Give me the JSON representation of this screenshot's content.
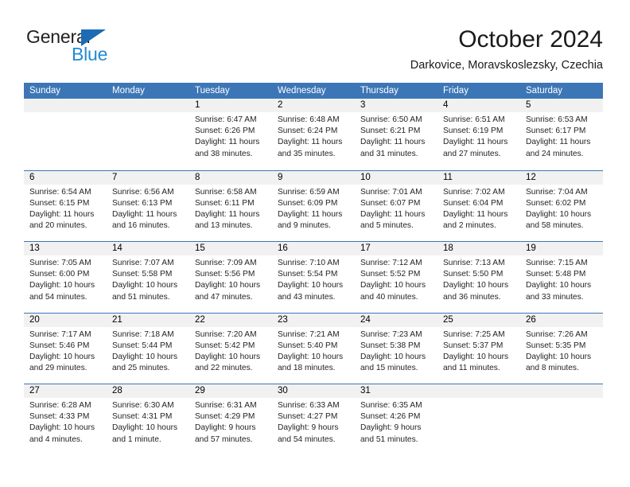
{
  "brand": {
    "name_top": "General",
    "name_bottom": "Blue",
    "triangle_icon": "blue-triangle-icon",
    "color_dark": "#231f20",
    "color_blue": "#2389d4"
  },
  "header": {
    "title": "October 2024",
    "subtitle": "Darkovice, Moravskoslezsky, Czechia"
  },
  "theme": {
    "header_blue": "#3d76b6",
    "date_strip_gray": "#f1f1f1",
    "text": "#231f20"
  },
  "calendar": {
    "weekdays": [
      "Sunday",
      "Monday",
      "Tuesday",
      "Wednesday",
      "Thursday",
      "Friday",
      "Saturday"
    ],
    "weeks": [
      [
        {
          "day": "",
          "lines": []
        },
        {
          "day": "",
          "lines": []
        },
        {
          "day": "1",
          "lines": [
            "Sunrise: 6:47 AM",
            "Sunset: 6:26 PM",
            "Daylight: 11 hours",
            "and 38 minutes."
          ]
        },
        {
          "day": "2",
          "lines": [
            "Sunrise: 6:48 AM",
            "Sunset: 6:24 PM",
            "Daylight: 11 hours",
            "and 35 minutes."
          ]
        },
        {
          "day": "3",
          "lines": [
            "Sunrise: 6:50 AM",
            "Sunset: 6:21 PM",
            "Daylight: 11 hours",
            "and 31 minutes."
          ]
        },
        {
          "day": "4",
          "lines": [
            "Sunrise: 6:51 AM",
            "Sunset: 6:19 PM",
            "Daylight: 11 hours",
            "and 27 minutes."
          ]
        },
        {
          "day": "5",
          "lines": [
            "Sunrise: 6:53 AM",
            "Sunset: 6:17 PM",
            "Daylight: 11 hours",
            "and 24 minutes."
          ]
        }
      ],
      [
        {
          "day": "6",
          "lines": [
            "Sunrise: 6:54 AM",
            "Sunset: 6:15 PM",
            "Daylight: 11 hours",
            "and 20 minutes."
          ]
        },
        {
          "day": "7",
          "lines": [
            "Sunrise: 6:56 AM",
            "Sunset: 6:13 PM",
            "Daylight: 11 hours",
            "and 16 minutes."
          ]
        },
        {
          "day": "8",
          "lines": [
            "Sunrise: 6:58 AM",
            "Sunset: 6:11 PM",
            "Daylight: 11 hours",
            "and 13 minutes."
          ]
        },
        {
          "day": "9",
          "lines": [
            "Sunrise: 6:59 AM",
            "Sunset: 6:09 PM",
            "Daylight: 11 hours",
            "and 9 minutes."
          ]
        },
        {
          "day": "10",
          "lines": [
            "Sunrise: 7:01 AM",
            "Sunset: 6:07 PM",
            "Daylight: 11 hours",
            "and 5 minutes."
          ]
        },
        {
          "day": "11",
          "lines": [
            "Sunrise: 7:02 AM",
            "Sunset: 6:04 PM",
            "Daylight: 11 hours",
            "and 2 minutes."
          ]
        },
        {
          "day": "12",
          "lines": [
            "Sunrise: 7:04 AM",
            "Sunset: 6:02 PM",
            "Daylight: 10 hours",
            "and 58 minutes."
          ]
        }
      ],
      [
        {
          "day": "13",
          "lines": [
            "Sunrise: 7:05 AM",
            "Sunset: 6:00 PM",
            "Daylight: 10 hours",
            "and 54 minutes."
          ]
        },
        {
          "day": "14",
          "lines": [
            "Sunrise: 7:07 AM",
            "Sunset: 5:58 PM",
            "Daylight: 10 hours",
            "and 51 minutes."
          ]
        },
        {
          "day": "15",
          "lines": [
            "Sunrise: 7:09 AM",
            "Sunset: 5:56 PM",
            "Daylight: 10 hours",
            "and 47 minutes."
          ]
        },
        {
          "day": "16",
          "lines": [
            "Sunrise: 7:10 AM",
            "Sunset: 5:54 PM",
            "Daylight: 10 hours",
            "and 43 minutes."
          ]
        },
        {
          "day": "17",
          "lines": [
            "Sunrise: 7:12 AM",
            "Sunset: 5:52 PM",
            "Daylight: 10 hours",
            "and 40 minutes."
          ]
        },
        {
          "day": "18",
          "lines": [
            "Sunrise: 7:13 AM",
            "Sunset: 5:50 PM",
            "Daylight: 10 hours",
            "and 36 minutes."
          ]
        },
        {
          "day": "19",
          "lines": [
            "Sunrise: 7:15 AM",
            "Sunset: 5:48 PM",
            "Daylight: 10 hours",
            "and 33 minutes."
          ]
        }
      ],
      [
        {
          "day": "20",
          "lines": [
            "Sunrise: 7:17 AM",
            "Sunset: 5:46 PM",
            "Daylight: 10 hours",
            "and 29 minutes."
          ]
        },
        {
          "day": "21",
          "lines": [
            "Sunrise: 7:18 AM",
            "Sunset: 5:44 PM",
            "Daylight: 10 hours",
            "and 25 minutes."
          ]
        },
        {
          "day": "22",
          "lines": [
            "Sunrise: 7:20 AM",
            "Sunset: 5:42 PM",
            "Daylight: 10 hours",
            "and 22 minutes."
          ]
        },
        {
          "day": "23",
          "lines": [
            "Sunrise: 7:21 AM",
            "Sunset: 5:40 PM",
            "Daylight: 10 hours",
            "and 18 minutes."
          ]
        },
        {
          "day": "24",
          "lines": [
            "Sunrise: 7:23 AM",
            "Sunset: 5:38 PM",
            "Daylight: 10 hours",
            "and 15 minutes."
          ]
        },
        {
          "day": "25",
          "lines": [
            "Sunrise: 7:25 AM",
            "Sunset: 5:37 PM",
            "Daylight: 10 hours",
            "and 11 minutes."
          ]
        },
        {
          "day": "26",
          "lines": [
            "Sunrise: 7:26 AM",
            "Sunset: 5:35 PM",
            "Daylight: 10 hours",
            "and 8 minutes."
          ]
        }
      ],
      [
        {
          "day": "27",
          "lines": [
            "Sunrise: 6:28 AM",
            "Sunset: 4:33 PM",
            "Daylight: 10 hours",
            "and 4 minutes."
          ]
        },
        {
          "day": "28",
          "lines": [
            "Sunrise: 6:30 AM",
            "Sunset: 4:31 PM",
            "Daylight: 10 hours",
            "and 1 minute."
          ]
        },
        {
          "day": "29",
          "lines": [
            "Sunrise: 6:31 AM",
            "Sunset: 4:29 PM",
            "Daylight: 9 hours",
            "and 57 minutes."
          ]
        },
        {
          "day": "30",
          "lines": [
            "Sunrise: 6:33 AM",
            "Sunset: 4:27 PM",
            "Daylight: 9 hours",
            "and 54 minutes."
          ]
        },
        {
          "day": "31",
          "lines": [
            "Sunrise: 6:35 AM",
            "Sunset: 4:26 PM",
            "Daylight: 9 hours",
            "and 51 minutes."
          ]
        },
        {
          "day": "",
          "lines": []
        },
        {
          "day": "",
          "lines": []
        }
      ]
    ]
  }
}
